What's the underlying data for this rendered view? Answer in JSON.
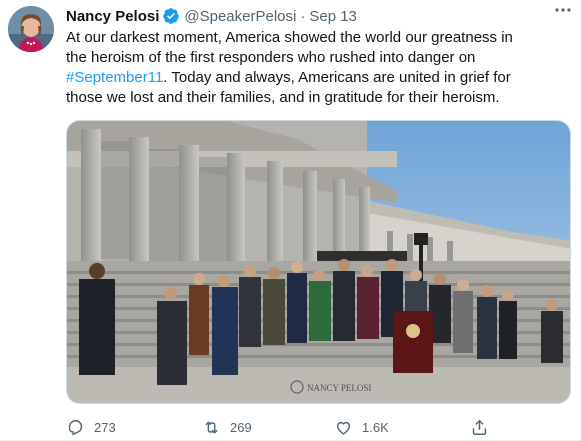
{
  "tweet": {
    "author": {
      "name": "Nancy Pelosi",
      "handle": "@SpeakerPelosi",
      "separator": "·",
      "date": "Sep 13",
      "verified": true
    },
    "text_line1": "At our darkest moment, America showed the world our greatness in",
    "text_line2": "the heroism of the first responders who rushed into danger on",
    "hashtag": "#September11",
    "text_line3_rest": ". Today and always, Americans are united in grief for",
    "text_line4": "those we lost and their families, and in gratitude for their heroism.",
    "media": {
      "description_icon": "photo",
      "watermark": "NANCY PELOSI"
    },
    "actions": {
      "reply_count": "273",
      "retweet_count": "269",
      "like_count": "1.6K"
    }
  },
  "colors": {
    "accent": "#1d9bf0",
    "text_primary": "#0f1419",
    "text_secondary": "#536471"
  },
  "icons": [
    "verified-badge-icon",
    "more-icon",
    "reply-icon",
    "retweet-icon",
    "like-icon",
    "share-icon"
  ]
}
